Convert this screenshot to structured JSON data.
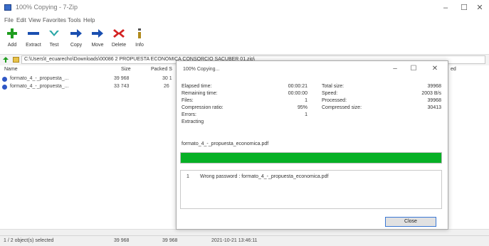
{
  "window": {
    "title": "100% Copying - 7-Zip",
    "minimize": "–",
    "maximize": "☐",
    "close": "✕"
  },
  "menu": [
    "File",
    "Edit",
    "View",
    "Favorites",
    "Tools",
    "Help"
  ],
  "toolbar": [
    {
      "label": "Add",
      "icon": "add-icon",
      "color": "#1f9d1f"
    },
    {
      "label": "Extract",
      "icon": "extract-icon",
      "color": "#1a4fb0"
    },
    {
      "label": "Test",
      "icon": "test-icon",
      "color": "#2aa7a7"
    },
    {
      "label": "Copy",
      "icon": "copy-icon",
      "color": "#1a4fb0"
    },
    {
      "label": "Move",
      "icon": "move-icon",
      "color": "#1a4fb0"
    },
    {
      "label": "Delete",
      "icon": "delete-icon",
      "color": "#d42222"
    },
    {
      "label": "Info",
      "icon": "info-icon",
      "color": "#555555"
    }
  ],
  "address": {
    "path": "C:\\Users\\t_ecuarecho\\Downloads\\00086 2 PROPUESTA ECONOMICA CONSORCIO SACUBER 01.zip\\"
  },
  "filelist": {
    "columns": [
      "Name",
      "Size",
      "Packed S"
    ],
    "rows": [
      {
        "name": "formato_4_-_propuesta_...",
        "size": "39 968",
        "packed": "30 1",
        "icon_color": "#2f57c5"
      },
      {
        "name": "formato_4_-_propuesta_...",
        "size": "33 743",
        "packed": "26",
        "icon_color": "#2f57c5"
      }
    ],
    "extra_column": "ed"
  },
  "status": {
    "selected": "1 / 2 object(s) selected",
    "size": "39 968",
    "packed": "39 968",
    "modified": "2021-10-21 13:46:11"
  },
  "dialog": {
    "title": "100% Copying...",
    "minimize": "–",
    "maximize": "☐",
    "close": "✕",
    "left_stats": [
      {
        "label": "Elapsed time:",
        "value": "00:00:21"
      },
      {
        "label": "Remaining time:",
        "value": "00:00:00"
      },
      {
        "label": "Files:",
        "value": "1"
      },
      {
        "label": "Compression ratio:",
        "value": "95%"
      },
      {
        "label": "Errors:",
        "value": "1"
      },
      {
        "label": "Extracting",
        "value": ""
      }
    ],
    "right_stats": [
      {
        "label": "Total size:",
        "value": "39968"
      },
      {
        "label": "Speed:",
        "value": "2003 B/s"
      },
      {
        "label": "Processed:",
        "value": "39968"
      },
      {
        "label": "Compressed size:",
        "value": "30413"
      }
    ],
    "current_file": "formato_4_-_propuesta_economica.pdf",
    "progress": 1.0,
    "progress_color": "#06b025",
    "messages": [
      {
        "num": "1",
        "text": "Wrong password : formato_4_-_propuesta_economica.pdf"
      }
    ],
    "close_label": "Close"
  }
}
